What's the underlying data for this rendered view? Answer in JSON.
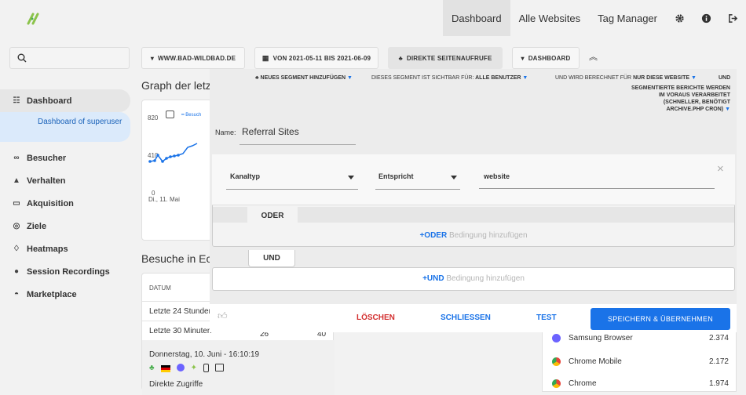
{
  "topnav": {
    "dashboard": "Dashboard",
    "websites": "Alle Websites",
    "tagmanager": "Tag Manager"
  },
  "sidebar": {
    "items": [
      {
        "label": "Dashboard",
        "icon": "grid-icon"
      },
      {
        "label": "Besucher",
        "icon": "binoculars-icon"
      },
      {
        "label": "Verhalten",
        "icon": "bell-icon"
      },
      {
        "label": "Akquisition",
        "icon": "window-icon"
      },
      {
        "label": "Ziele",
        "icon": "target-icon"
      },
      {
        "label": "Heatmaps",
        "icon": "flame-icon"
      },
      {
        "label": "Session Recordings",
        "icon": "play-icon"
      },
      {
        "label": "Marketplace",
        "icon": "marketplace-icon"
      }
    ],
    "sub": "Dashboard of superuser"
  },
  "toolbar": {
    "site": "WWW.BAD-WILDBAD.DE",
    "period": "VON 2021-05-11 BIS 2021-06-09",
    "segment": "DIREKTE SEITENAUFRUFE",
    "dashboard": "DASHBOARD"
  },
  "background": {
    "graph_title": "Graph der letzt",
    "y820": "820",
    "y410": "410",
    "y0": "0",
    "xlabel": "Di., 11. Mai",
    "legend": "Besuch",
    "visits_title": "Besuche in Ec",
    "col_datum": "DATUM",
    "row1": "Letzte 24 Stunder",
    "row2": "Letzte 30 Minuten",
    "row2_v1": "26",
    "row2_v2": "40",
    "visit_time": "Donnerstag, 10. Juni - 16:10:19",
    "visit_src": "Direkte Zugriffe",
    "browsers": [
      {
        "name": "Samsung Browser",
        "value": "2.374",
        "color": "#6c63ff"
      },
      {
        "name": "Chrome Mobile",
        "value": "2.172",
        "color": "#e8453c"
      },
      {
        "name": "Chrome",
        "value": "1.974",
        "color": "#e8453c"
      }
    ]
  },
  "editor": {
    "add_segment": "NEUES SEGMENT HINZUFÜGEN",
    "visible_for": "DIESES SEGMENT IST SICHTBAR FÜR:",
    "visible_value": "ALLE BENUTZER",
    "computed_for": "UND WIRD BERECHNET FÜR",
    "computed_value": "NUR DIESE WEBSITE",
    "and": "UND",
    "processing_1": "SEGMENTIERTE BERICHTE WERDEN",
    "processing_2": "IM VORAUS VERARBEITET",
    "processing_3": "(SCHNELLER, BENÖTIGT",
    "processing_4": "ARCHIVE.PHP CRON)",
    "name_label": "Name:",
    "name_value": "Referral Sites",
    "dimension": "Kanaltyp",
    "operator": "Entspricht",
    "value": "website",
    "or_label": "ODER",
    "or_add_bold": "+ODER",
    "or_add_rest": " Bedingung hinzufügen",
    "and_label": "UND",
    "and_add_bold": "+UND",
    "and_add_rest": " Bedingung hinzufügen",
    "delete": "LÖSCHEN",
    "close": "SCHLIESSEN",
    "test": "TEST",
    "save": "SPEICHERN & ÜBERNEHMEN"
  },
  "colors": {
    "accent": "#1a73e8",
    "danger": "#d32f2f",
    "logo": "#8bc34a"
  }
}
